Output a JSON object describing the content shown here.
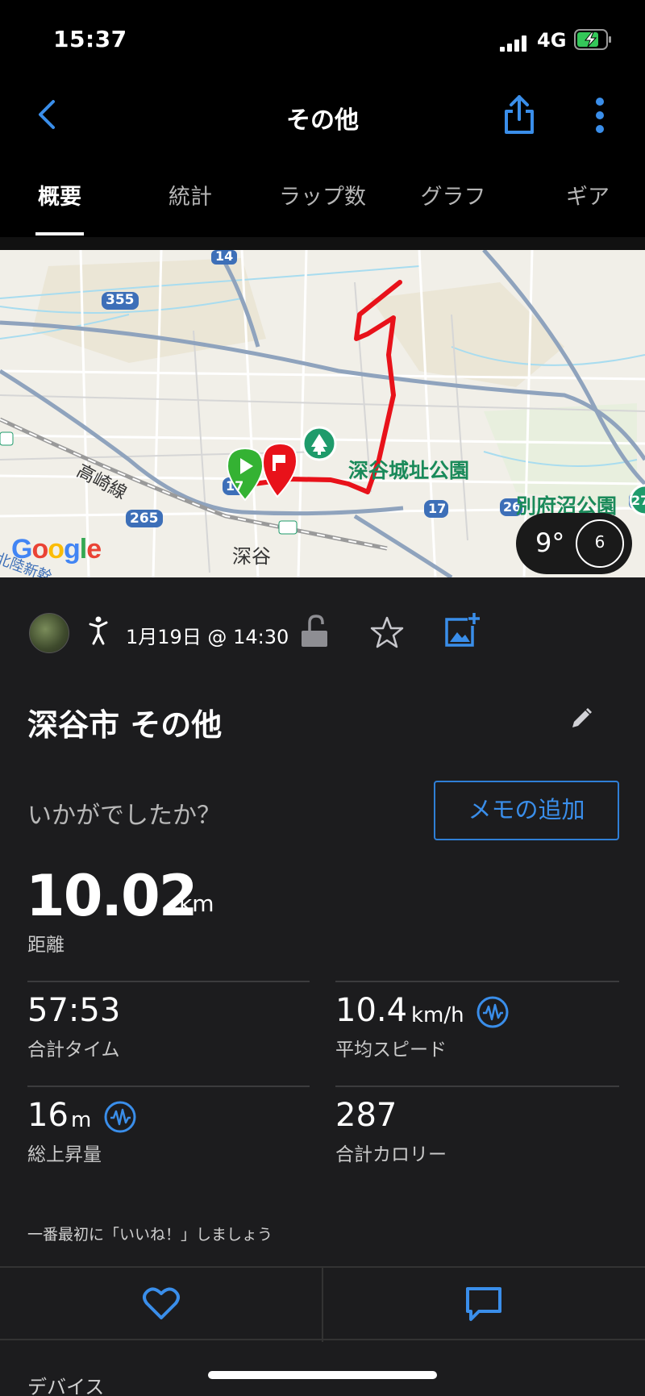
{
  "status": {
    "time": "15:37",
    "network": "4G"
  },
  "nav": {
    "title": "その他"
  },
  "tabs": [
    {
      "label": "概要",
      "active": true
    },
    {
      "label": "統計",
      "active": false
    },
    {
      "label": "ラップ数",
      "active": false
    },
    {
      "label": "グラフ",
      "active": false
    },
    {
      "label": "ギア",
      "active": false
    }
  ],
  "map": {
    "road_numbers": [
      "14",
      "355",
      "17",
      "17",
      "265",
      "26",
      "27"
    ],
    "places": {
      "park1": "深谷城址公園",
      "park2": "別府沼公園",
      "station": "深谷",
      "line": "高崎線",
      "corner": "北陸新幹"
    },
    "logo": "Google",
    "weather": {
      "temp": "9°",
      "wind": "6"
    },
    "route_color": "#e8121a"
  },
  "activity": {
    "date": "1月19日 @ 14:30",
    "title": "深谷市 その他",
    "memo_prompt": "いかがでしたか？",
    "memo_button": "メモの追加"
  },
  "stats": {
    "distance": {
      "value": "10.02",
      "unit": "km",
      "label": "距離"
    },
    "time": {
      "value": "57:53",
      "label": "合計タイム"
    },
    "speed": {
      "value": "10.4",
      "unit": "km/h",
      "label": "平均スピード"
    },
    "ascent": {
      "value": "16",
      "unit": "m",
      "label": "総上昇量"
    },
    "calories": {
      "value": "287",
      "label": "合計カロリー"
    }
  },
  "social": {
    "like_prompt": "一番最初に「いいね！」しましょう"
  },
  "device_label": "デバイス",
  "colors": {
    "accent": "#3a8eea",
    "background": "#1c1c1e",
    "header": "#000000"
  }
}
